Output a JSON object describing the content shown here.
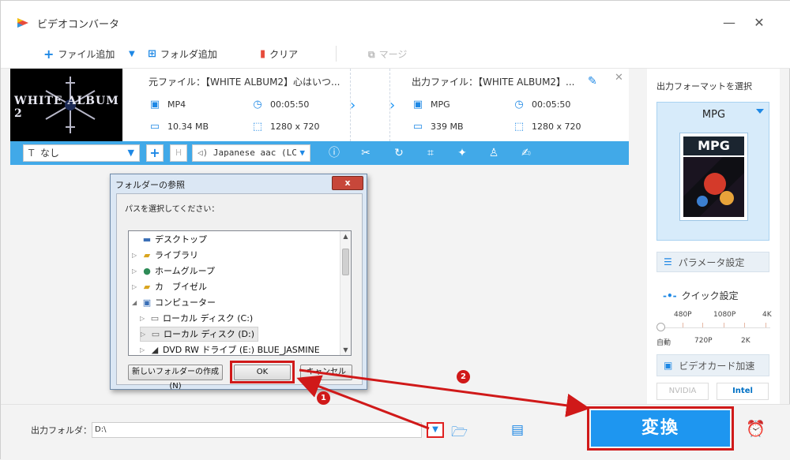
{
  "window": {
    "title": "ビデオコンバータ",
    "minimize": "—",
    "close": "✕"
  },
  "toolbar": {
    "add_file": "ファイル追加",
    "add_folder": "フォルダ追加",
    "clear": "クリア",
    "merge": "マージ"
  },
  "file": {
    "thumb_text": "WHITE ALBUM 2",
    "source_name": "元ファイル：【WHITE ALBUM2】心はいつ...",
    "source_format": "MP4",
    "source_duration": "00:05:50",
    "source_size": "10.34 MB",
    "source_resolution": "1280 x 720",
    "output_name": "出力ファイル：【WHITE ALBUM2】...",
    "output_format": "MPG",
    "output_duration": "00:05:50",
    "output_size": "339 MB",
    "output_resolution": "1280 x 720"
  },
  "editbar": {
    "subtitle": "なし",
    "audio": "Japanese aac (LC"
  },
  "right_panel": {
    "title": "出力フォーマットを選択",
    "format": "MPG",
    "format_icon_text": "MPG",
    "param_settings": "パラメータ設定",
    "quick_settings": "クイック設定",
    "quality_top": [
      "480P",
      "1080P",
      "4K"
    ],
    "quality_bottom": [
      "自動",
      "720P",
      "2K"
    ],
    "gpu_accel": "ビデオカード加速",
    "nvidia": "NVIDIA",
    "intel": "Intel"
  },
  "bottom": {
    "output_label": "出力フォルダ：",
    "output_path": "D:\\",
    "convert": "変換"
  },
  "dialog": {
    "title": "フォルダーの参照",
    "close": "x",
    "prompt": "パスを選択してください：",
    "tree": [
      "デスクトップ",
      "ライブラリ",
      "ホームグループ",
      "カ　ブイゼル",
      "コンピューター",
      "ローカル ディスク (C:)",
      "ローカル ディスク (D:)",
      "DVD RW ドライブ (E:) BLUE_JASMINE"
    ],
    "new_folder": "新しいフォルダーの作成(N)",
    "ok": "OK",
    "cancel": "キャンセル"
  },
  "annotations": {
    "step1": "1",
    "step2": "2"
  }
}
